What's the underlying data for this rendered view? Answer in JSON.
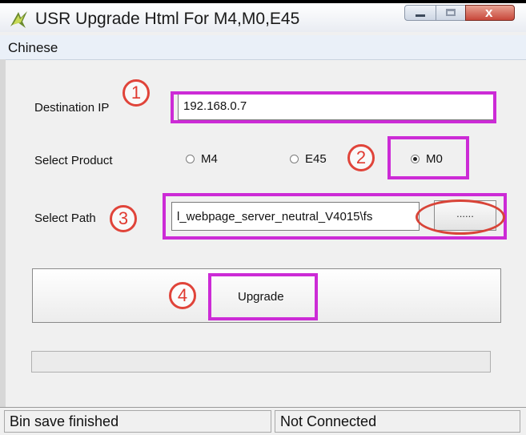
{
  "window": {
    "title": "USR Upgrade Html For M4,M0,E45",
    "controls": {
      "minimize_icon": "minimize-icon",
      "maximize_icon": "maximize-icon",
      "close_icon": "close-icon",
      "close_glyph": "x"
    }
  },
  "menu": {
    "items": [
      "Chinese"
    ]
  },
  "form": {
    "destination_ip": {
      "label": "Destination IP",
      "value": "192.168.0.7"
    },
    "select_product": {
      "label": "Select Product",
      "options": [
        "M4",
        "E45",
        "M0"
      ],
      "selected": "M0"
    },
    "select_path": {
      "label": "Select Path",
      "value": "l_webpage_server_neutral_V4015\\fs",
      "browse_label": "......"
    },
    "upgrade_button": {
      "label": "Upgrade"
    },
    "progress": {
      "value": 0
    }
  },
  "statusbar": {
    "left": "Bin save finished",
    "right": "Not Connected"
  },
  "annotations": {
    "step1": "1",
    "step2": "2",
    "step3": "3",
    "step4": "4",
    "highlight_color": "#cc2bd6",
    "circle_color": "#e0443a"
  }
}
